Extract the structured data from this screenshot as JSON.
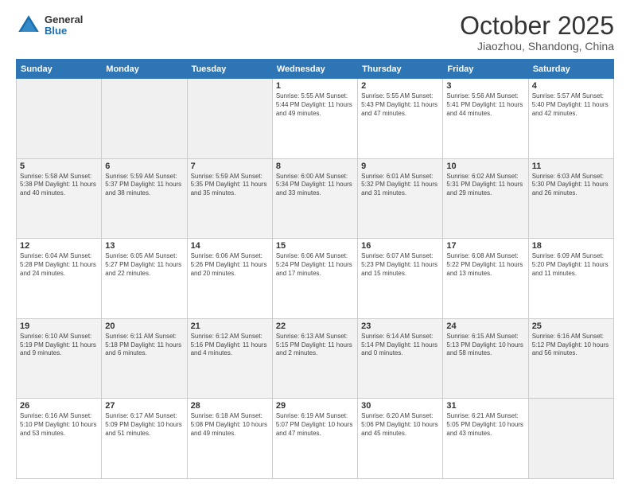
{
  "header": {
    "logo_general": "General",
    "logo_blue": "Blue",
    "month": "October 2025",
    "location": "Jiaozhou, Shandong, China"
  },
  "weekdays": [
    "Sunday",
    "Monday",
    "Tuesday",
    "Wednesday",
    "Thursday",
    "Friday",
    "Saturday"
  ],
  "weeks": [
    [
      {
        "day": "",
        "info": ""
      },
      {
        "day": "",
        "info": ""
      },
      {
        "day": "",
        "info": ""
      },
      {
        "day": "1",
        "info": "Sunrise: 5:55 AM\nSunset: 5:44 PM\nDaylight: 11 hours\nand 49 minutes."
      },
      {
        "day": "2",
        "info": "Sunrise: 5:55 AM\nSunset: 5:43 PM\nDaylight: 11 hours\nand 47 minutes."
      },
      {
        "day": "3",
        "info": "Sunrise: 5:56 AM\nSunset: 5:41 PM\nDaylight: 11 hours\nand 44 minutes."
      },
      {
        "day": "4",
        "info": "Sunrise: 5:57 AM\nSunset: 5:40 PM\nDaylight: 11 hours\nand 42 minutes."
      }
    ],
    [
      {
        "day": "5",
        "info": "Sunrise: 5:58 AM\nSunset: 5:38 PM\nDaylight: 11 hours\nand 40 minutes."
      },
      {
        "day": "6",
        "info": "Sunrise: 5:59 AM\nSunset: 5:37 PM\nDaylight: 11 hours\nand 38 minutes."
      },
      {
        "day": "7",
        "info": "Sunrise: 5:59 AM\nSunset: 5:35 PM\nDaylight: 11 hours\nand 35 minutes."
      },
      {
        "day": "8",
        "info": "Sunrise: 6:00 AM\nSunset: 5:34 PM\nDaylight: 11 hours\nand 33 minutes."
      },
      {
        "day": "9",
        "info": "Sunrise: 6:01 AM\nSunset: 5:32 PM\nDaylight: 11 hours\nand 31 minutes."
      },
      {
        "day": "10",
        "info": "Sunrise: 6:02 AM\nSunset: 5:31 PM\nDaylight: 11 hours\nand 29 minutes."
      },
      {
        "day": "11",
        "info": "Sunrise: 6:03 AM\nSunset: 5:30 PM\nDaylight: 11 hours\nand 26 minutes."
      }
    ],
    [
      {
        "day": "12",
        "info": "Sunrise: 6:04 AM\nSunset: 5:28 PM\nDaylight: 11 hours\nand 24 minutes."
      },
      {
        "day": "13",
        "info": "Sunrise: 6:05 AM\nSunset: 5:27 PM\nDaylight: 11 hours\nand 22 minutes."
      },
      {
        "day": "14",
        "info": "Sunrise: 6:06 AM\nSunset: 5:26 PM\nDaylight: 11 hours\nand 20 minutes."
      },
      {
        "day": "15",
        "info": "Sunrise: 6:06 AM\nSunset: 5:24 PM\nDaylight: 11 hours\nand 17 minutes."
      },
      {
        "day": "16",
        "info": "Sunrise: 6:07 AM\nSunset: 5:23 PM\nDaylight: 11 hours\nand 15 minutes."
      },
      {
        "day": "17",
        "info": "Sunrise: 6:08 AM\nSunset: 5:22 PM\nDaylight: 11 hours\nand 13 minutes."
      },
      {
        "day": "18",
        "info": "Sunrise: 6:09 AM\nSunset: 5:20 PM\nDaylight: 11 hours\nand 11 minutes."
      }
    ],
    [
      {
        "day": "19",
        "info": "Sunrise: 6:10 AM\nSunset: 5:19 PM\nDaylight: 11 hours\nand 9 minutes."
      },
      {
        "day": "20",
        "info": "Sunrise: 6:11 AM\nSunset: 5:18 PM\nDaylight: 11 hours\nand 6 minutes."
      },
      {
        "day": "21",
        "info": "Sunrise: 6:12 AM\nSunset: 5:16 PM\nDaylight: 11 hours\nand 4 minutes."
      },
      {
        "day": "22",
        "info": "Sunrise: 6:13 AM\nSunset: 5:15 PM\nDaylight: 11 hours\nand 2 minutes."
      },
      {
        "day": "23",
        "info": "Sunrise: 6:14 AM\nSunset: 5:14 PM\nDaylight: 11 hours\nand 0 minutes."
      },
      {
        "day": "24",
        "info": "Sunrise: 6:15 AM\nSunset: 5:13 PM\nDaylight: 10 hours\nand 58 minutes."
      },
      {
        "day": "25",
        "info": "Sunrise: 6:16 AM\nSunset: 5:12 PM\nDaylight: 10 hours\nand 56 minutes."
      }
    ],
    [
      {
        "day": "26",
        "info": "Sunrise: 6:16 AM\nSunset: 5:10 PM\nDaylight: 10 hours\nand 53 minutes."
      },
      {
        "day": "27",
        "info": "Sunrise: 6:17 AM\nSunset: 5:09 PM\nDaylight: 10 hours\nand 51 minutes."
      },
      {
        "day": "28",
        "info": "Sunrise: 6:18 AM\nSunset: 5:08 PM\nDaylight: 10 hours\nand 49 minutes."
      },
      {
        "day": "29",
        "info": "Sunrise: 6:19 AM\nSunset: 5:07 PM\nDaylight: 10 hours\nand 47 minutes."
      },
      {
        "day": "30",
        "info": "Sunrise: 6:20 AM\nSunset: 5:06 PM\nDaylight: 10 hours\nand 45 minutes."
      },
      {
        "day": "31",
        "info": "Sunrise: 6:21 AM\nSunset: 5:05 PM\nDaylight: 10 hours\nand 43 minutes."
      },
      {
        "day": "",
        "info": ""
      }
    ]
  ]
}
